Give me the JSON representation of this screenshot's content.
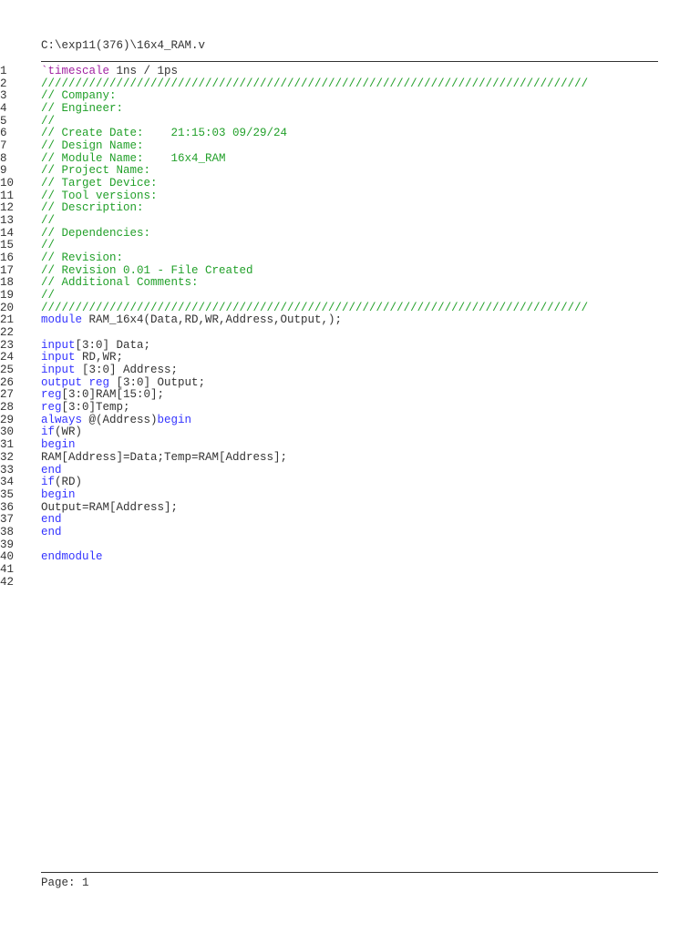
{
  "header": {
    "file_path": "C:\\exp11(376)\\16x4_RAM.v"
  },
  "footer": {
    "page_label": "Page: 1"
  },
  "colors": {
    "keyword": "#3333ff",
    "comment": "#22a02a",
    "directive": "#a020a0",
    "text": "#333333"
  },
  "lines": [
    [
      [
        "p",
        "`timescale"
      ],
      [
        "t",
        " 1ns / 1ps"
      ]
    ],
    [
      [
        "c",
        "////////////////////////////////////////////////////////////////////////////////"
      ]
    ],
    [
      [
        "c",
        "// Company:"
      ]
    ],
    [
      [
        "c",
        "// Engineer:"
      ]
    ],
    [
      [
        "c",
        "//"
      ]
    ],
    [
      [
        "c",
        "// Create Date:    21:15:03 09/29/24"
      ]
    ],
    [
      [
        "c",
        "// Design Name:"
      ]
    ],
    [
      [
        "c",
        "// Module Name:    16x4_RAM"
      ]
    ],
    [
      [
        "c",
        "// Project Name:"
      ]
    ],
    [
      [
        "c",
        "// Target Device:"
      ]
    ],
    [
      [
        "c",
        "// Tool versions:"
      ]
    ],
    [
      [
        "c",
        "// Description:"
      ]
    ],
    [
      [
        "c",
        "//"
      ]
    ],
    [
      [
        "c",
        "// Dependencies:"
      ]
    ],
    [
      [
        "c",
        "//"
      ]
    ],
    [
      [
        "c",
        "// Revision:"
      ]
    ],
    [
      [
        "c",
        "// Revision 0.01 - File Created"
      ]
    ],
    [
      [
        "c",
        "// Additional Comments:"
      ]
    ],
    [
      [
        "c",
        "//"
      ]
    ],
    [
      [
        "c",
        "////////////////////////////////////////////////////////////////////////////////"
      ]
    ],
    [
      [
        "k",
        "module"
      ],
      [
        "t",
        " RAM_16x4(Data,RD,WR,Address,Output,);"
      ]
    ],
    [],
    [
      [
        "k",
        "input"
      ],
      [
        "t",
        "[3:0] Data;"
      ]
    ],
    [
      [
        "k",
        "input"
      ],
      [
        "t",
        " RD,WR;"
      ]
    ],
    [
      [
        "k",
        "input"
      ],
      [
        "t",
        " [3:0] Address;"
      ]
    ],
    [
      [
        "k",
        "output"
      ],
      [
        "t",
        " "
      ],
      [
        "k",
        "reg"
      ],
      [
        "t",
        " [3:0] Output;"
      ]
    ],
    [
      [
        "k",
        "reg"
      ],
      [
        "t",
        "[3:0]RAM[15:0];"
      ]
    ],
    [
      [
        "k",
        "reg"
      ],
      [
        "t",
        "[3:0]Temp;"
      ]
    ],
    [
      [
        "k",
        "always"
      ],
      [
        "t",
        " @(Address)"
      ],
      [
        "k",
        "begin"
      ]
    ],
    [
      [
        "k",
        "if"
      ],
      [
        "t",
        "(WR)"
      ]
    ],
    [
      [
        "k",
        "begin"
      ]
    ],
    [
      [
        "t",
        "RAM[Address]=Data;Temp=RAM[Address];"
      ]
    ],
    [
      [
        "k",
        "end"
      ]
    ],
    [
      [
        "k",
        "if"
      ],
      [
        "t",
        "(RD)"
      ]
    ],
    [
      [
        "k",
        "begin"
      ]
    ],
    [
      [
        "t",
        "Output=RAM[Address];"
      ]
    ],
    [
      [
        "k",
        "end"
      ]
    ],
    [
      [
        "k",
        "end"
      ]
    ],
    [],
    [
      [
        "k",
        "endmodule"
      ]
    ],
    [],
    []
  ]
}
